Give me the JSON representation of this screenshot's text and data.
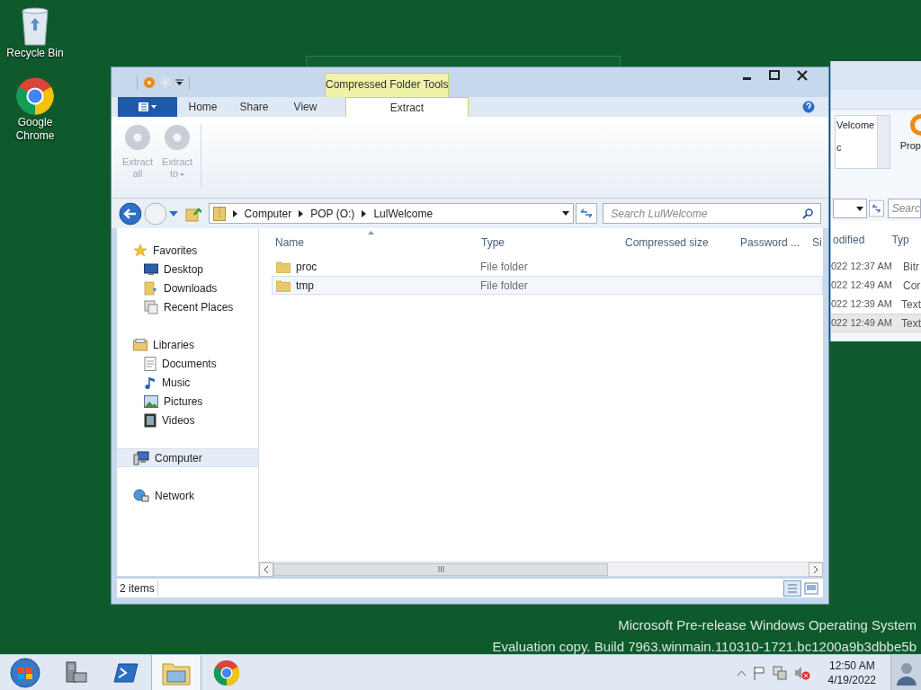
{
  "desktop_icons": [
    {
      "kind": "recycle",
      "label": "Recycle Bin"
    },
    {
      "kind": "chrome",
      "label": "Google Chrome"
    }
  ],
  "background_window": {
    "list_lines": [
      "Velcome",
      "c"
    ],
    "ribbon_button": "Prop",
    "search_placeholder": "Searc",
    "column_headers": [
      "odified",
      "Typ"
    ],
    "rows": [
      {
        "modified": "022 12:37 AM",
        "type": "Bitr",
        "selected": false
      },
      {
        "modified": "022 12:49 AM",
        "type": "Cor",
        "selected": false
      },
      {
        "modified": "022 12:39 AM",
        "type": "Text",
        "selected": false
      },
      {
        "modified": "022 12:49 AM",
        "type": "Text",
        "selected": true
      }
    ]
  },
  "window": {
    "contextual_group": "Compressed Folder Tools",
    "tabs": [
      {
        "label": "Home",
        "selected": false
      },
      {
        "label": "Share",
        "selected": false
      },
      {
        "label": "View",
        "selected": false
      },
      {
        "label": "Extract",
        "selected": true
      }
    ],
    "ribbon_buttons": [
      {
        "label": "Extract all",
        "disabled": true,
        "dropdown": false
      },
      {
        "label": "Extract to",
        "disabled": true,
        "dropdown": true
      }
    ],
    "breadcrumbs": [
      "Computer",
      "POP (O:)",
      "LulWelcome"
    ],
    "search": {
      "placeholder": "Search LulWelcome"
    },
    "nav": [
      {
        "kind": "favorites",
        "label": "Favorites",
        "selected": false,
        "children": [
          {
            "kind": "desktop",
            "label": "Desktop",
            "selected": false
          },
          {
            "kind": "downloads",
            "label": "Downloads",
            "selected": false
          },
          {
            "kind": "recent",
            "label": "Recent Places",
            "selected": false
          }
        ]
      },
      {
        "kind": "libraries",
        "label": "Libraries",
        "selected": false,
        "children": [
          {
            "kind": "documents",
            "label": "Documents",
            "selected": false
          },
          {
            "kind": "music",
            "label": "Music",
            "selected": false
          },
          {
            "kind": "pictures",
            "label": "Pictures",
            "selected": false
          },
          {
            "kind": "videos",
            "label": "Videos",
            "selected": false
          }
        ]
      },
      {
        "kind": "computer",
        "label": "Computer",
        "selected": true
      },
      {
        "kind": "network",
        "label": "Network",
        "selected": false
      }
    ],
    "columns": [
      "Name",
      "Type",
      "Compressed size",
      "Password ...",
      "Si"
    ],
    "rows": [
      {
        "name": "proc",
        "type": "File folder",
        "hovered": false
      },
      {
        "name": "tmp",
        "type": "File folder",
        "hovered": true
      }
    ],
    "status": "2 items"
  },
  "watermark": [
    "Microsoft Pre-release Windows Operating System",
    "Evaluation copy. Build 7963.winmain.110310-1721.bc1200a9b3dbbe5b"
  ],
  "taskbar": {
    "apps": [
      {
        "kind": "server",
        "active": false
      },
      {
        "kind": "powershell",
        "active": false
      },
      {
        "kind": "explorer",
        "active": true
      },
      {
        "kind": "chrome",
        "active": false
      }
    ],
    "time": "12:50 AM",
    "date": "4/19/2022"
  }
}
